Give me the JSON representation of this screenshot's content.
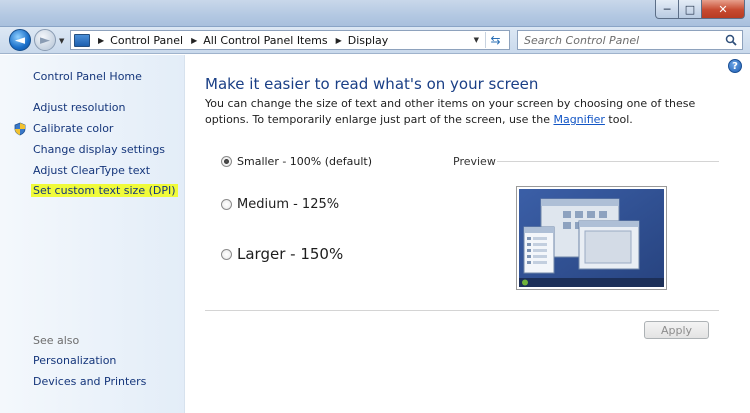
{
  "window": {
    "minimize_glyph": "─",
    "maximize_glyph": "□",
    "close_glyph": "✕"
  },
  "address_bar": {
    "back_glyph": "◄",
    "forward_glyph": "►",
    "breadcrumbs": [
      "Control Panel",
      "All Control Panel Items",
      "Display"
    ],
    "search_placeholder": "Search Control Panel",
    "refresh_glyph": "⇆"
  },
  "sidebar": {
    "home": "Control Panel Home",
    "items": [
      {
        "label": "Adjust resolution",
        "icon": null
      },
      {
        "label": "Calibrate color",
        "icon": "shield-icon"
      },
      {
        "label": "Change display settings",
        "icon": null
      },
      {
        "label": "Adjust ClearType text",
        "icon": null
      },
      {
        "label": "Set custom text size (DPI)",
        "icon": null,
        "highlighted": true
      }
    ],
    "see_also_label": "See also",
    "see_also": [
      "Personalization",
      "Devices and Printers"
    ]
  },
  "main": {
    "heading": "Make it easier to read what's on your screen",
    "description_before_link": "You can change the size of text and other items on your screen by choosing one of these options. To temporarily enlarge just part of the screen, use the ",
    "description_link": "Magnifier",
    "description_after_link": " tool.",
    "options": [
      {
        "label": "Smaller - 100% (default)",
        "checked": true
      },
      {
        "label": "Medium - 125%",
        "checked": false
      },
      {
        "label": "Larger - 150%",
        "checked": false
      }
    ],
    "preview_label": "Preview",
    "apply_label": "Apply",
    "help_glyph": "?"
  },
  "colors": {
    "link": "#15367b",
    "heading": "#1a3f86",
    "highlight": "#f0fb3a"
  }
}
